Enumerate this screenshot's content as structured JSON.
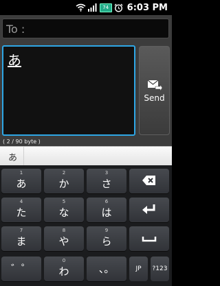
{
  "status": {
    "time": "6:03 PM",
    "battery": "74"
  },
  "compose": {
    "to_label": "To :",
    "message_text": "あ",
    "send_label": "Send",
    "byte_count": "( 2 / 90 byte )"
  },
  "candidates": [
    "あ"
  ],
  "keyboard": {
    "row1": [
      {
        "sub": "1",
        "main": "あ"
      },
      {
        "sub": "2",
        "main": "か"
      },
      {
        "sub": "3",
        "main": "さ"
      }
    ],
    "row2": [
      {
        "sub": "4",
        "main": "た"
      },
      {
        "sub": "5",
        "main": "な"
      },
      {
        "sub": "6",
        "main": "は"
      }
    ],
    "row3": [
      {
        "sub": "7",
        "main": "ま"
      },
      {
        "sub": "8",
        "main": "や"
      },
      {
        "sub": "9",
        "main": "ら"
      }
    ],
    "row4": [
      {
        "sub": "*",
        "main": "゛゜"
      },
      {
        "sub": "0",
        "main": "わ"
      },
      {
        "sub": "#",
        "main": "、。"
      }
    ],
    "lang_label": "JP",
    "mode_label": "?123"
  }
}
